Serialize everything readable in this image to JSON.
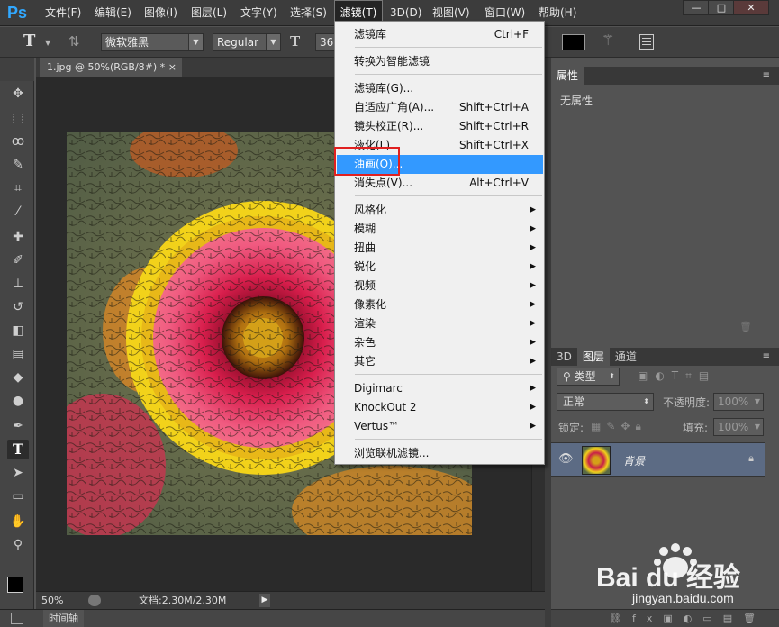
{
  "app": {
    "logo": "Ps"
  },
  "menubar": {
    "items": [
      "文件(F)",
      "编辑(E)",
      "图像(I)",
      "图层(L)",
      "文字(Y)",
      "选择(S)",
      "滤镜(T)",
      "3D(D)",
      "视图(V)",
      "窗口(W)",
      "帮助(H)"
    ],
    "active": "滤镜(T)"
  },
  "window_controls": {
    "minimize": "—",
    "maximize": "□",
    "close": "✕"
  },
  "options": {
    "font_family": "微软雅黑",
    "font_style": "Regular",
    "font_size": "36",
    "text_color": "#000000"
  },
  "document": {
    "tab_title": "1.jpg @ 50%(RGB/8#) *",
    "tab_close": "×",
    "zoom": "50%",
    "doc_info": "文档:2.30M/2.30M"
  },
  "timeline": {
    "label": "时间轴"
  },
  "filter_menu": {
    "items": [
      {
        "label": "滤镜库",
        "shortcut": "Ctrl+F"
      },
      {
        "label": "转换为智能滤镜",
        "shortcut": ""
      },
      {
        "label": "滤镜库(G)...",
        "shortcut": ""
      },
      {
        "label": "自适应广角(A)...",
        "shortcut": "Shift+Ctrl+A"
      },
      {
        "label": "镜头校正(R)...",
        "shortcut": "Shift+Ctrl+R"
      },
      {
        "label": "液化(L)...",
        "shortcut": "Shift+Ctrl+X"
      },
      {
        "label": "油画(O)...",
        "shortcut": ""
      },
      {
        "label": "消失点(V)...",
        "shortcut": "Alt+Ctrl+V"
      },
      {
        "label": "风格化",
        "shortcut": ""
      },
      {
        "label": "模糊",
        "shortcut": ""
      },
      {
        "label": "扭曲",
        "shortcut": ""
      },
      {
        "label": "锐化",
        "shortcut": ""
      },
      {
        "label": "视频",
        "shortcut": ""
      },
      {
        "label": "像素化",
        "shortcut": ""
      },
      {
        "label": "渲染",
        "shortcut": ""
      },
      {
        "label": "杂色",
        "shortcut": ""
      },
      {
        "label": "其它",
        "shortcut": ""
      },
      {
        "label": "Digimarc",
        "shortcut": ""
      },
      {
        "label": "KnockOut 2",
        "shortcut": ""
      },
      {
        "label": "Vertus™",
        "shortcut": ""
      },
      {
        "label": "浏览联机滤镜...",
        "shortcut": ""
      }
    ],
    "highlighted": "油画(O)...",
    "highlight_color": "#3399ff",
    "annotation_box_color": "#e02020"
  },
  "properties_panel": {
    "tab": "属性",
    "content": "无属性"
  },
  "layers_panel": {
    "tabs": [
      "3D",
      "图层",
      "通道"
    ],
    "active_tab": "图层",
    "filter_kind": "类型",
    "blend_mode": "正常",
    "opacity_label": "不透明度:",
    "opacity_value": "100%",
    "lock_label": "锁定:",
    "fill_label": "填充:",
    "fill_value": "100%",
    "layers": [
      {
        "name": "背景",
        "locked": true,
        "visible": true
      }
    ]
  },
  "watermark": {
    "brand": "Bai du 经验",
    "url": "jingyan.baidu.com"
  }
}
